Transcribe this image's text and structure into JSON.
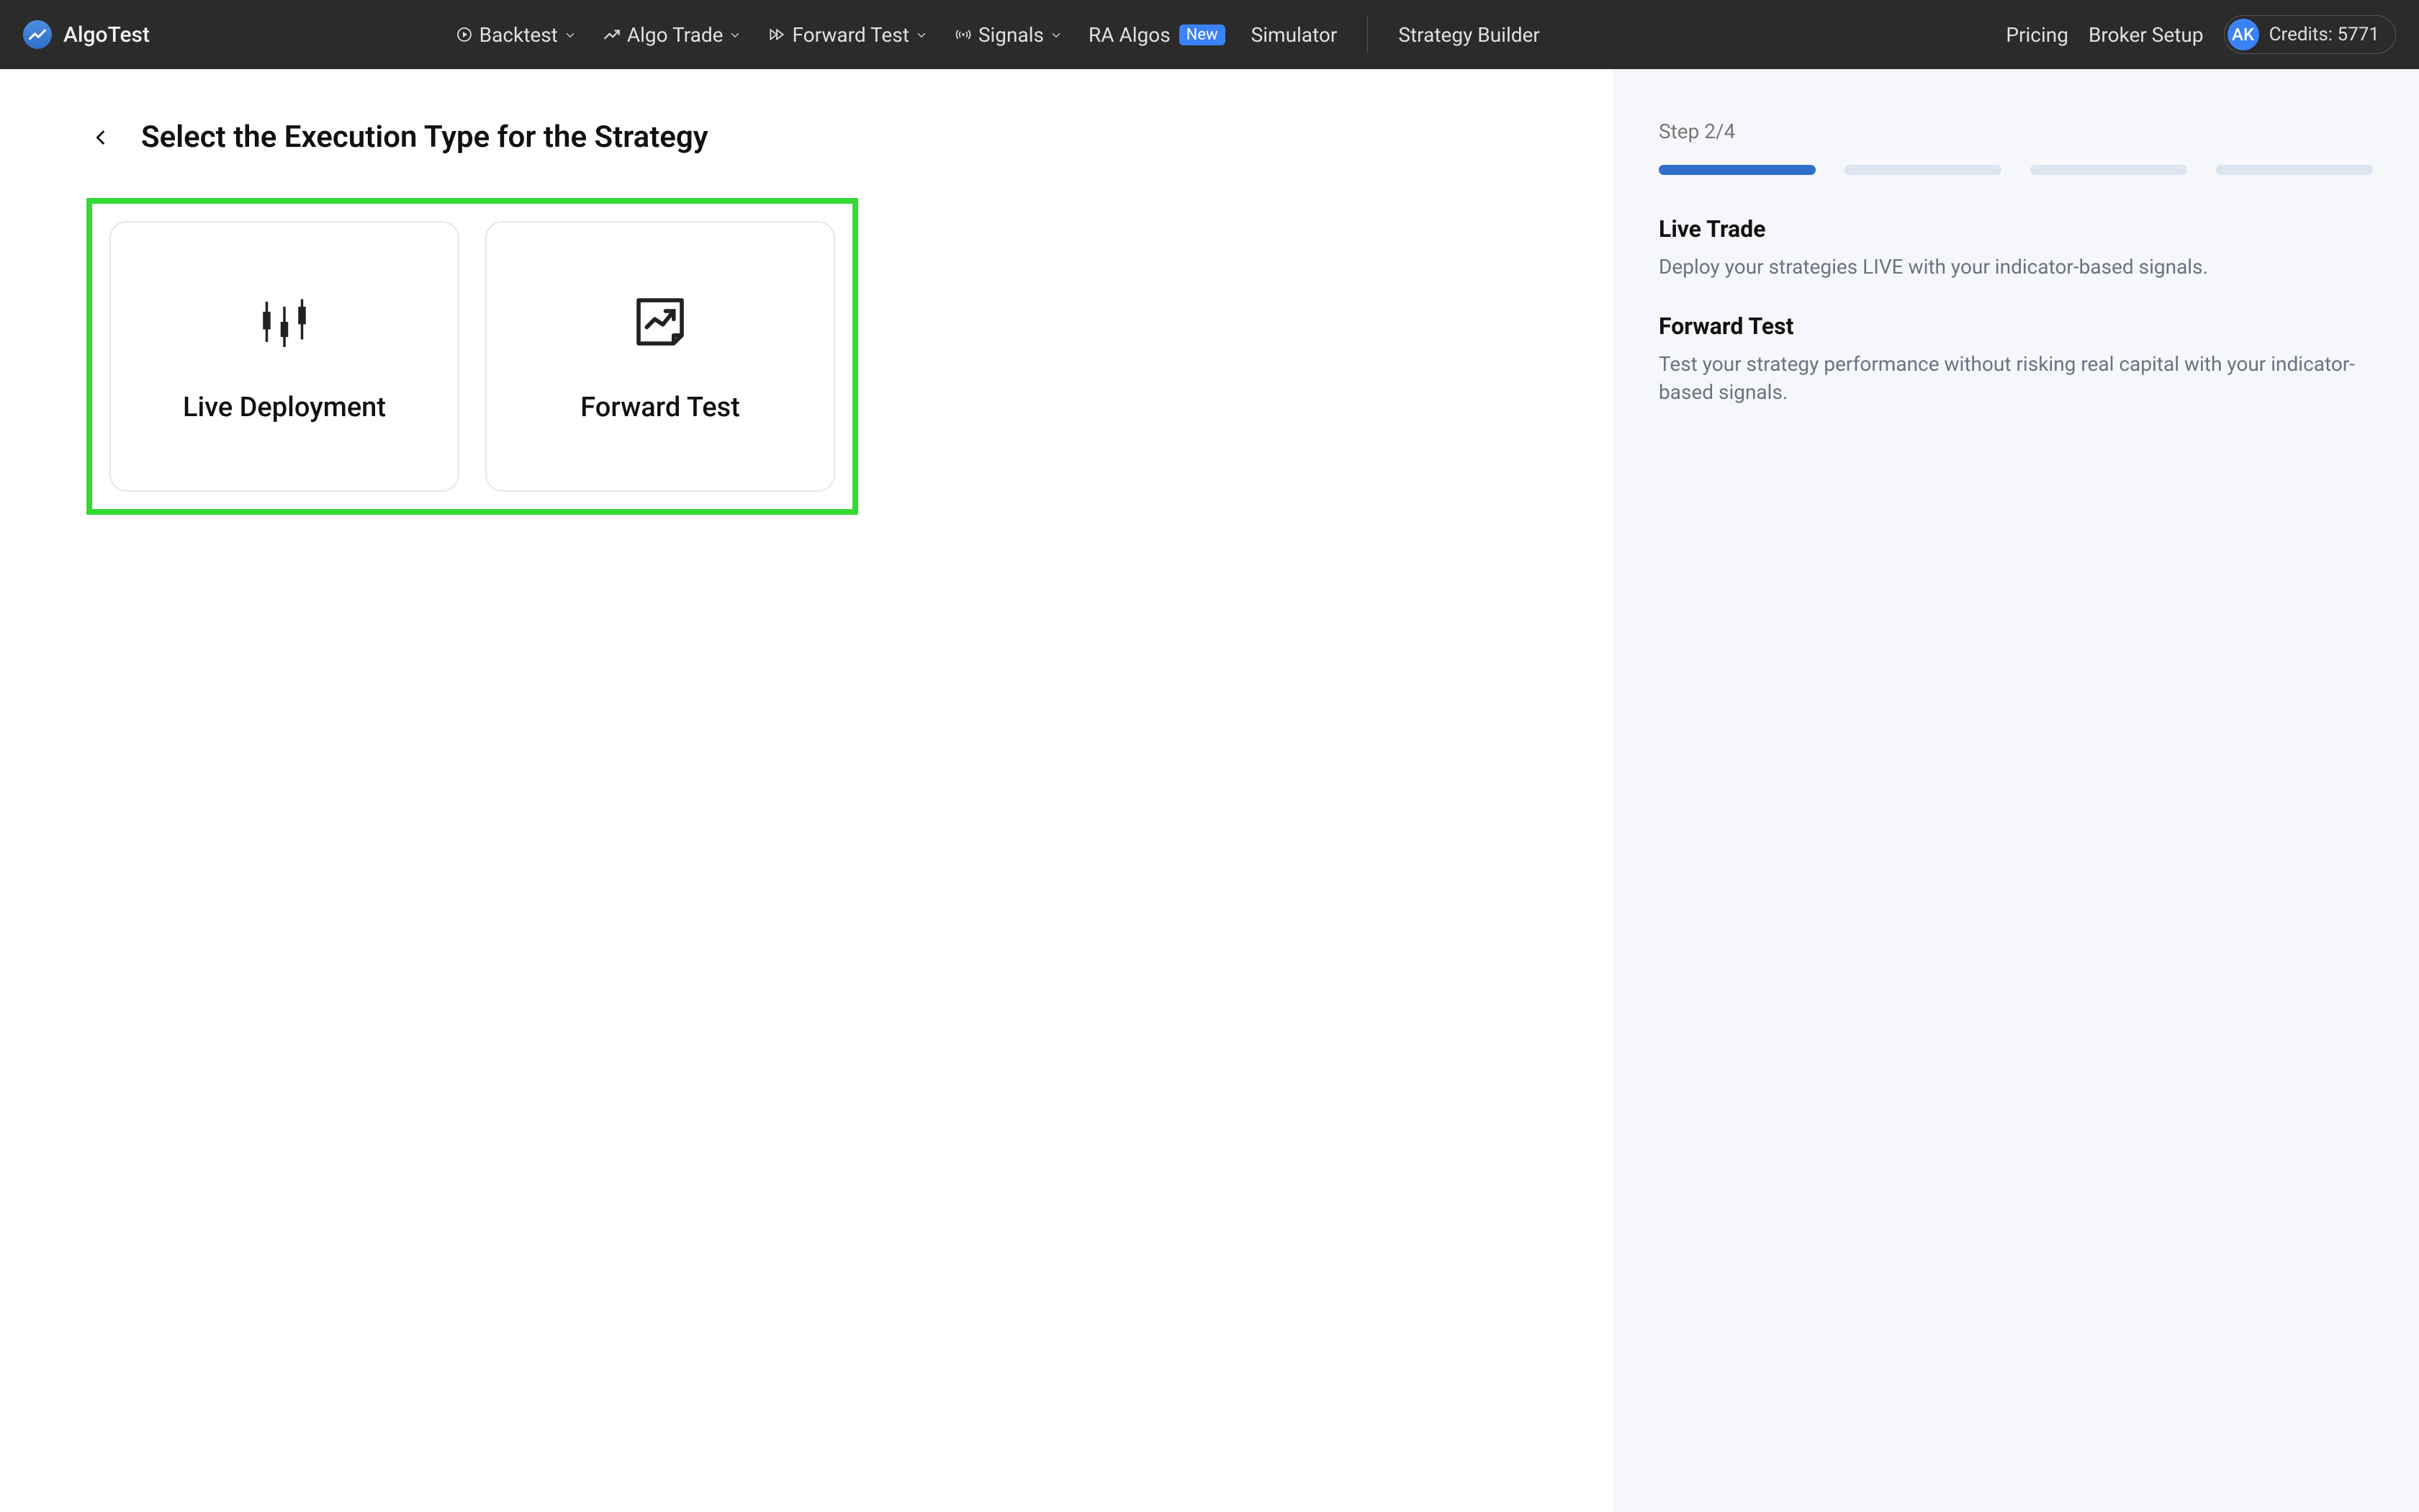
{
  "brand": {
    "name": "AlgoTest"
  },
  "nav": {
    "items": [
      {
        "label": "Backtest",
        "icon": "play-circle",
        "dropdown": true
      },
      {
        "label": "Algo Trade",
        "icon": "trend-up",
        "dropdown": true
      },
      {
        "label": "Forward Test",
        "icon": "fast-forward",
        "dropdown": true
      },
      {
        "label": "Signals",
        "icon": "broadcast",
        "dropdown": true
      },
      {
        "label": "RA Algos",
        "badge": "New"
      },
      {
        "label": "Simulator"
      },
      {
        "label": "Strategy Builder"
      }
    ],
    "right": {
      "pricing": "Pricing",
      "broker_setup": "Broker Setup",
      "avatar_initials": "AK",
      "credits_label": "Credits: 5771"
    }
  },
  "page": {
    "title": "Select the Execution Type for the Strategy"
  },
  "options": {
    "live": {
      "label": "Live Deployment"
    },
    "forward": {
      "label": "Forward Test"
    }
  },
  "sidebar": {
    "step_text": "Step 2/4",
    "progress_total": 4,
    "progress_filled": 1,
    "sections": [
      {
        "title": "Live Trade",
        "body": "Deploy your strategies LIVE with your indicator-based signals."
      },
      {
        "title": "Forward Test",
        "body": "Test your strategy performance without risking real capital with your indicator-based signals."
      }
    ]
  }
}
